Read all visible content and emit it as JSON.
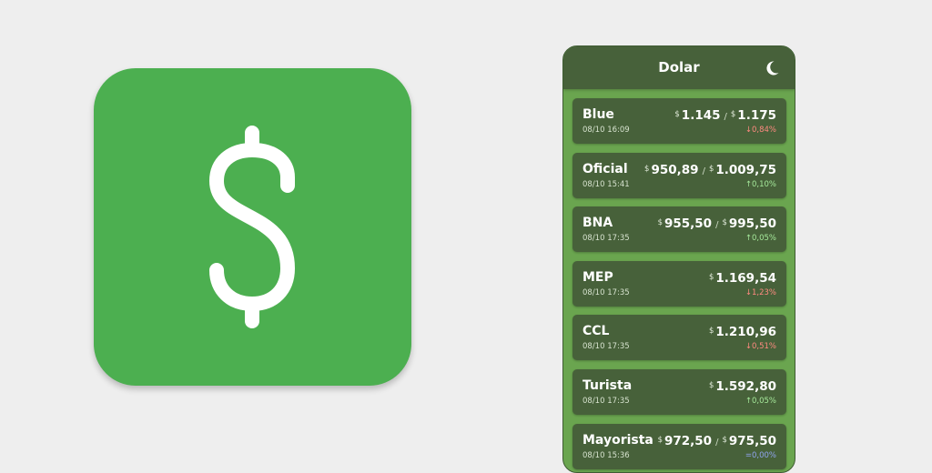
{
  "colors": {
    "page_background": "#eeeeee",
    "icon_background": "#4caf50",
    "panel_background": "#6aa54f",
    "header_background": "#47613a",
    "card_background": "#47613a",
    "change_down": "#ff8a80",
    "change_up": "#a5e89a",
    "change_flat": "#90a4f0"
  },
  "app_icon": {
    "icon": "dollar-sign-icon"
  },
  "header": {
    "title": "Dolar",
    "theme_icon": "moon-icon"
  },
  "quotes": [
    {
      "name": "Blue",
      "date": "08/10 16:09",
      "currency": "$",
      "buy": "1.145",
      "sell": "1.175",
      "separator": "/",
      "change": "↓0,84%",
      "direction": "down"
    },
    {
      "name": "Oficial",
      "date": "08/10 15:41",
      "currency": "$",
      "buy": "950,89",
      "sell": "1.009,75",
      "separator": "/",
      "change": "↑0,10%",
      "direction": "up"
    },
    {
      "name": "BNA",
      "date": "08/10 17:35",
      "currency": "$",
      "buy": "955,50",
      "sell": "995,50",
      "separator": "/",
      "change": "↑0,05%",
      "direction": "up"
    },
    {
      "name": "MEP",
      "date": "08/10 17:35",
      "currency": "$",
      "sell": "1.169,54",
      "change": "↓1,23%",
      "direction": "down"
    },
    {
      "name": "CCL",
      "date": "08/10 17:35",
      "currency": "$",
      "sell": "1.210,96",
      "change": "↓0,51%",
      "direction": "down"
    },
    {
      "name": "Turista",
      "date": "08/10 17:35",
      "currency": "$",
      "sell": "1.592,80",
      "change": "↑0,05%",
      "direction": "up"
    },
    {
      "name": "Mayorista",
      "date": "08/10 15:36",
      "currency": "$",
      "buy": "972,50",
      "sell": "975,50",
      "separator": "/",
      "change": "=0,00%",
      "direction": "flat"
    }
  ]
}
